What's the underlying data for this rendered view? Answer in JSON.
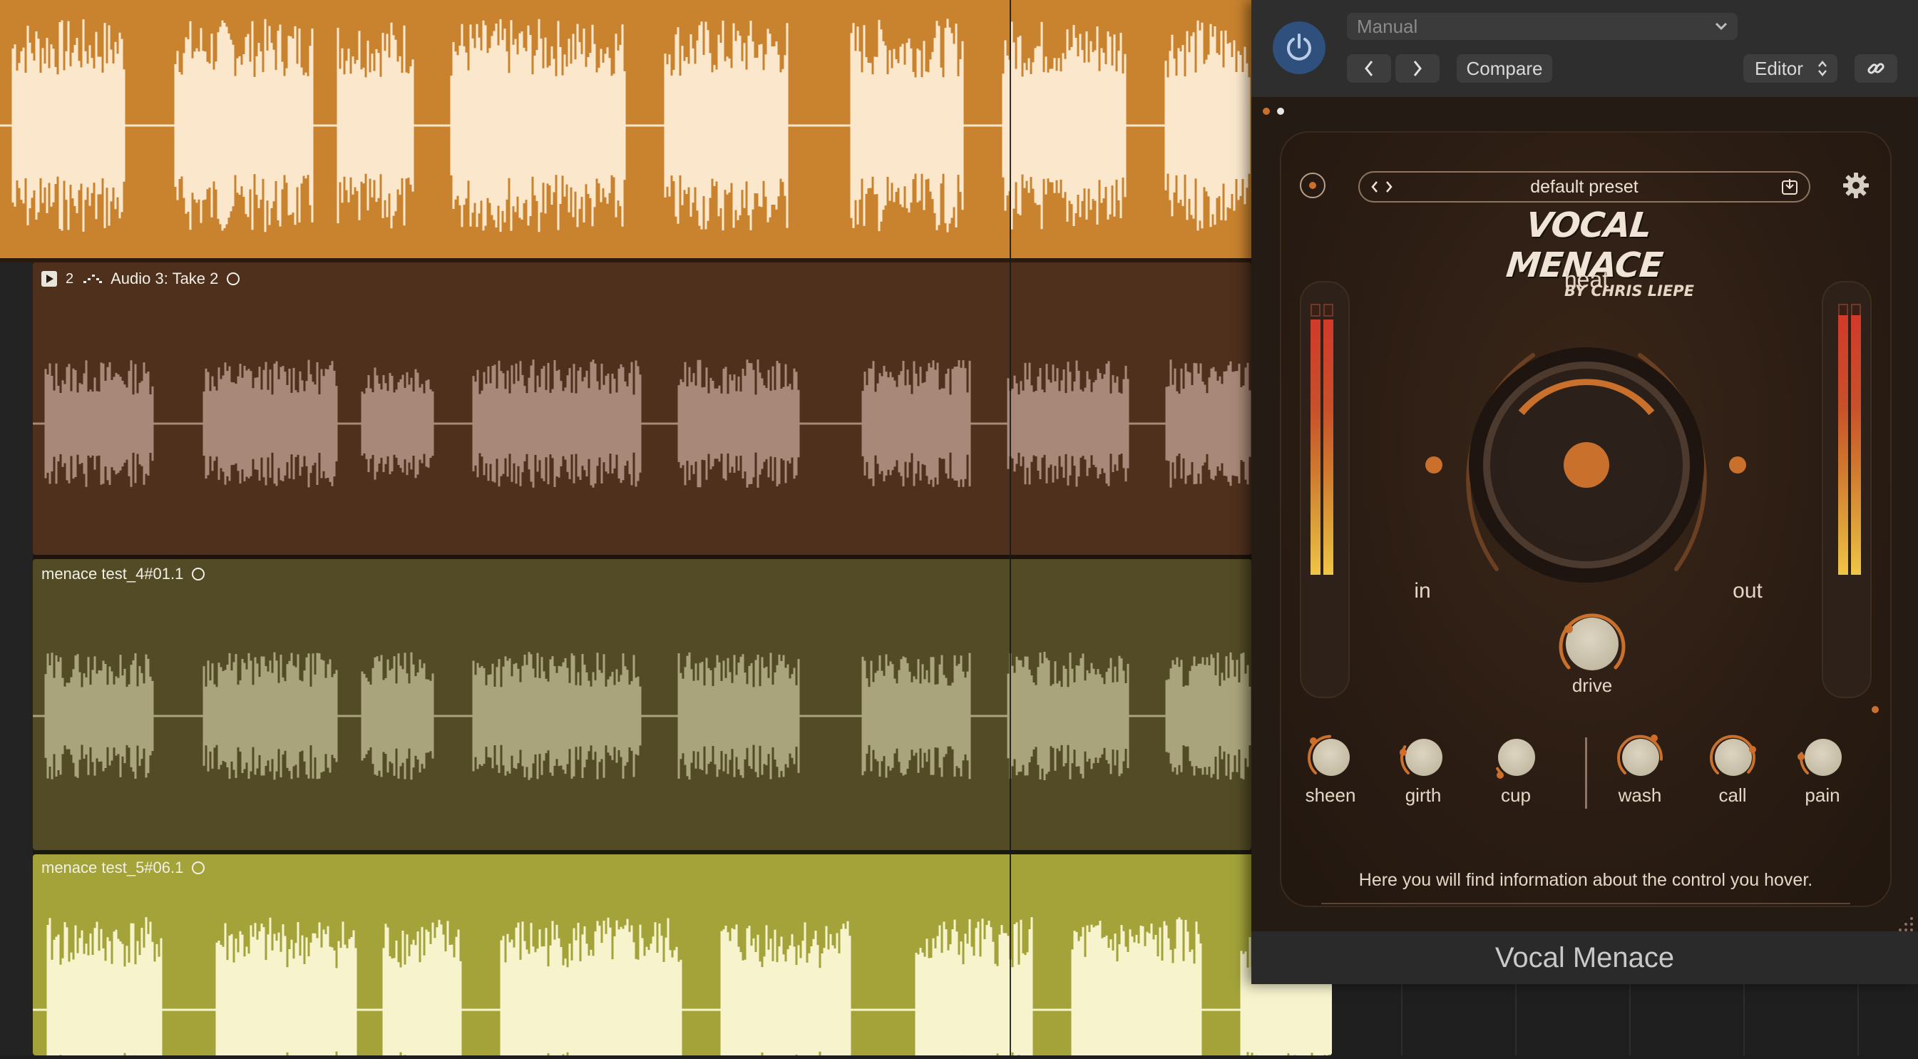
{
  "tracks": [
    {
      "label": "",
      "color": "#c9832f",
      "wave_color": "#fbe8cc"
    },
    {
      "loop_number": "2",
      "label": "Audio 3: Take 2",
      "color": "#4e301d",
      "wave_color": "#a88878"
    },
    {
      "label": "menace test_4#01.1",
      "color": "#524b25",
      "wave_color": "#a9a47c"
    },
    {
      "label": "menace test_5#06.1",
      "color": "#a3a33a",
      "wave_color": "#f6f3cd"
    }
  ],
  "plugin_header": {
    "setting_dropdown": "Manual",
    "compare_button": "Compare",
    "view_select": "Editor",
    "power_color": "#2f4f7d"
  },
  "plugin": {
    "preset_name": "default preset",
    "logo_title": "VOCAL MENACE",
    "logo_subtitle": "BY CHRIS LIEPE",
    "heat_label": "heat",
    "in_label": "in",
    "out_label": "out",
    "drive_label": "drive",
    "knobs": [
      "sheen",
      "girth",
      "cup",
      "wash",
      "call",
      "pain"
    ],
    "info_text": "Here you will find information about the control you hover.",
    "accent_color": "#c8702c"
  },
  "footer_title": "Vocal Menace"
}
